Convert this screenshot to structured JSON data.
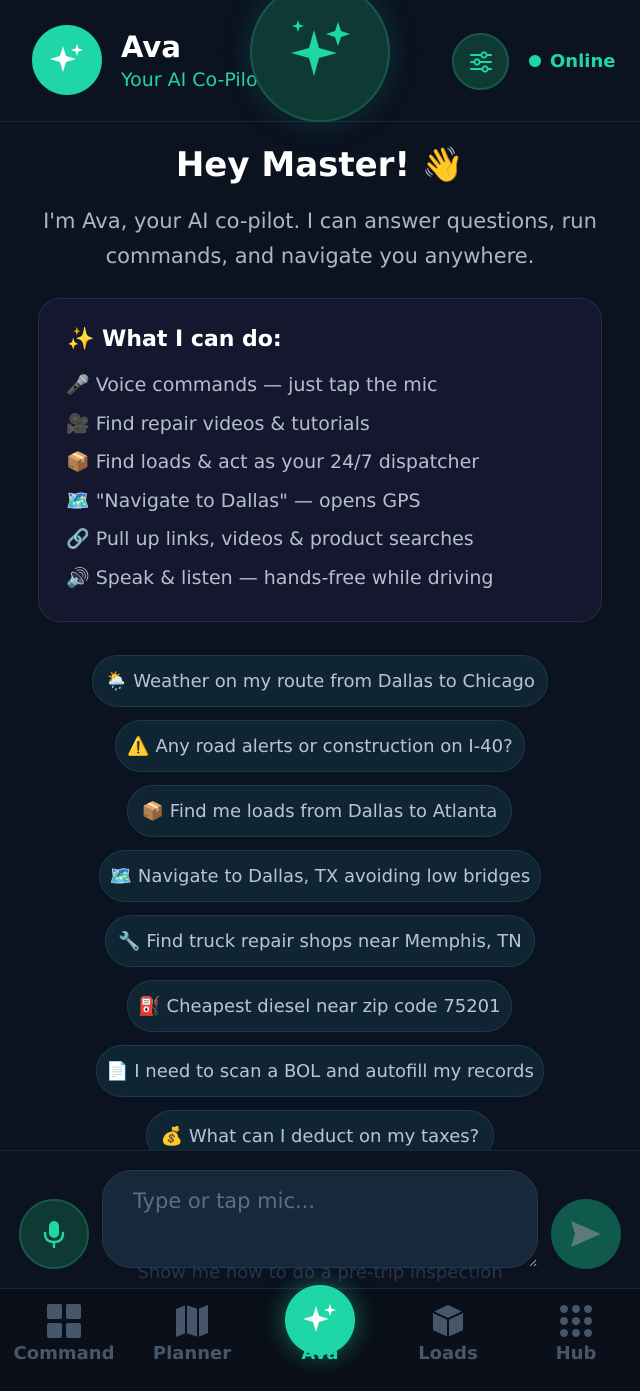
{
  "header": {
    "name": "Ava",
    "subtitle": "Your AI Co-Pilot",
    "status": "Online"
  },
  "greeting": {
    "title": "Hey Master! 👋",
    "body": "I'm Ava, your AI co-pilot. I can answer questions, run commands, and navigate you anywhere."
  },
  "capabilities": {
    "title": "✨ What I can do:",
    "items": [
      "🎤 Voice commands — just tap the mic",
      "🎥 Find repair videos & tutorials",
      "📦 Find loads & act as your 24/7 dispatcher",
      "🗺️ \"Navigate to Dallas\" — opens GPS",
      "🔗 Pull up links, videos & product searches",
      "🔊 Speak & listen — hands-free while driving"
    ]
  },
  "suggestions": [
    "🌦️ Weather on my route from Dallas to Chicago",
    "⚠️ Any road alerts or construction on I-40?",
    "📦 Find me loads from Dallas to Atlanta",
    "🗺️ Navigate to Dallas, TX avoiding low bridges",
    "🔧 Find truck repair shops near Memphis, TN",
    "⛽ Cheapest diesel near zip code 75201",
    "📄 I need to scan a BOL and autofill my records",
    "💰 What can I deduct on my taxes?"
  ],
  "ghost_suggestion": "Show me how to do a pre-trip inspection",
  "composer": {
    "placeholder": "Type or tap mic..."
  },
  "nav": [
    {
      "label": "Command",
      "icon": "grid-icon"
    },
    {
      "label": "Planner",
      "icon": "map-icon"
    },
    {
      "label": "Ava",
      "icon": "sparkle-icon"
    },
    {
      "label": "Loads",
      "icon": "box-icon"
    },
    {
      "label": "Hub",
      "icon": "dots-grid-icon"
    }
  ],
  "colors": {
    "accent": "#1ed6a6",
    "background": "#0b1220",
    "card": "#15172e",
    "chip": "#0f2533"
  }
}
